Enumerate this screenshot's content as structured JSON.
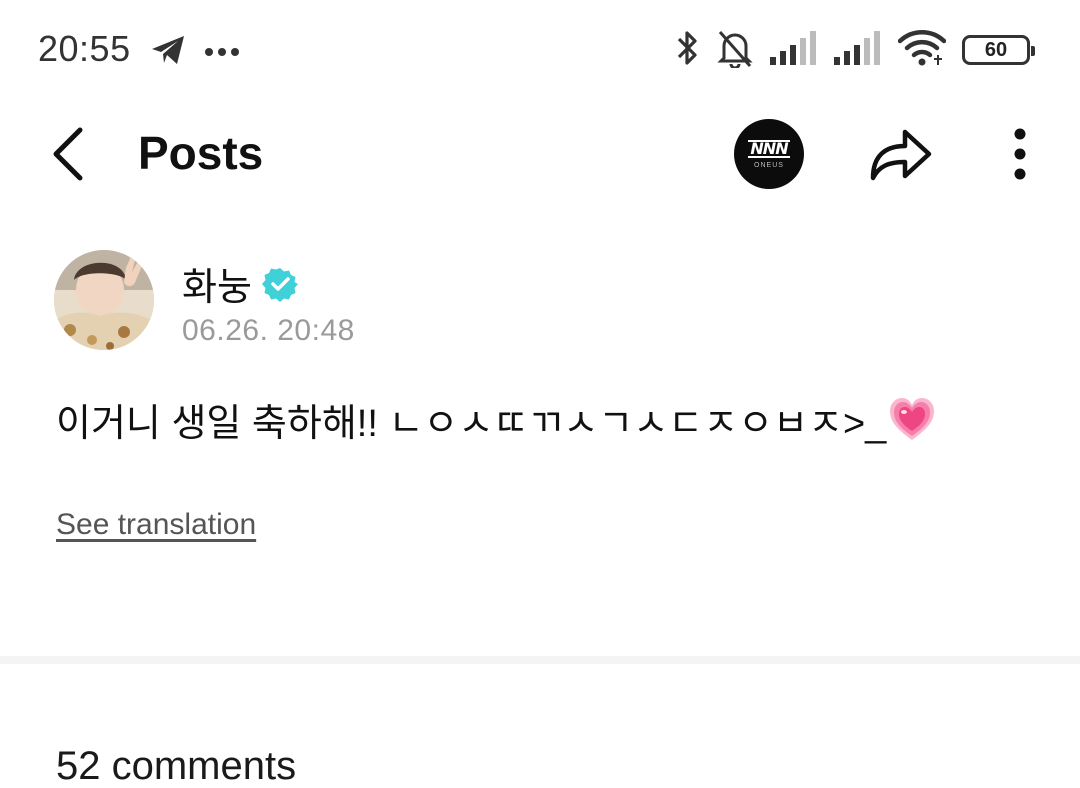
{
  "status_bar": {
    "time": "20:55",
    "left_icons": [
      "telegram-icon",
      "more-dots-icon"
    ],
    "right_icons": [
      "bluetooth-icon",
      "bell-muted-icon",
      "signal-icon",
      "signal-icon",
      "wifi-icon"
    ],
    "battery": "60"
  },
  "header": {
    "title": "Posts",
    "channel_logo_text": "ONEUS"
  },
  "post": {
    "author": "화눙",
    "verified": true,
    "time": "06.26. 20:48",
    "body": "이거니 생일 축하해!! ㄴㅇㅅㄸㄲㅅㄱㅅㄷㅈㅇㅂㅈ>_",
    "emoji": "growing-heart-icon",
    "translate_label": "See translation"
  },
  "comments": {
    "count_label": "52 comments"
  },
  "colors": {
    "verified": "#3fd0d8",
    "heart": "#f0508a",
    "muted_text": "#9a9a9a"
  }
}
